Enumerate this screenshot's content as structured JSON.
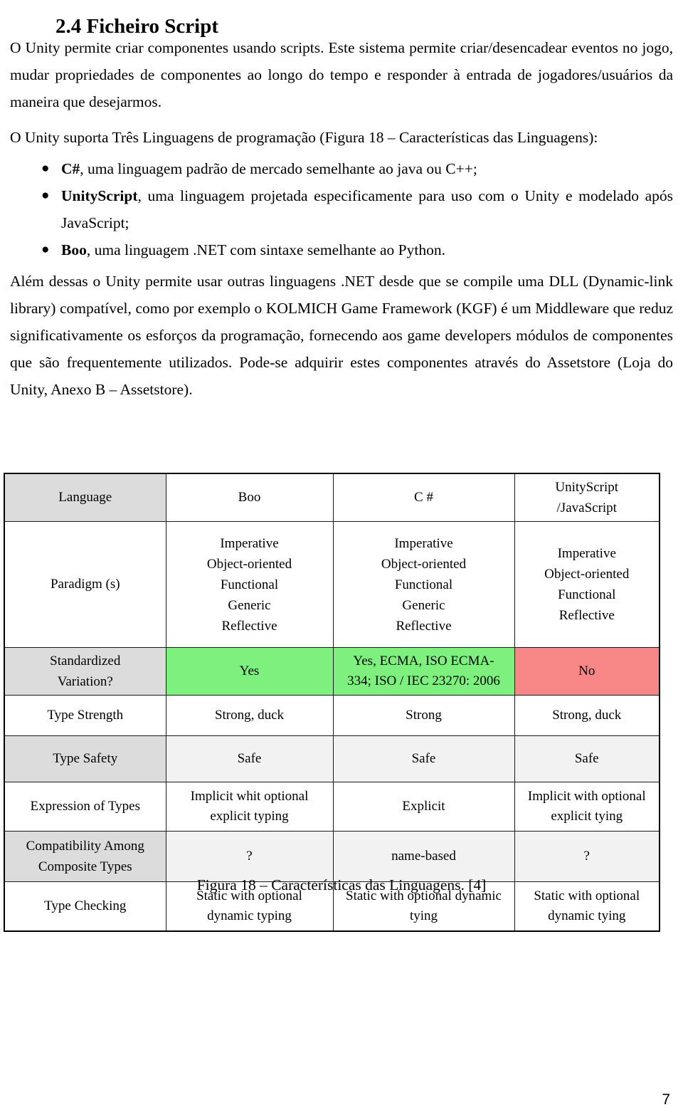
{
  "document": {
    "heading": "2.4 Ficheiro Script",
    "page_number": "7"
  },
  "paragraphs": {
    "intro": "O Unity permite criar componentes usando scripts. Este sistema permite criar/desencadear eventos no jogo, mudar propriedades de componentes ao longo do tempo e responder à entrada de jogadores/usuários da maneira que desejarmos.",
    "languages_lead": "O Unity suporta Três Linguagens de programação (Figura 18 – Características das Linguagens):",
    "closing": "Além dessas o Unity permite usar outras linguagens .NET desde que se compile uma DLL (Dynamic-link library) compatível, como por exemplo o KOLMICH Game Framework (KGF) é um Middleware que reduz significativamente os esforços da programação, fornecendo aos game developers módulos de componentes que são frequentemente utilizados. Pode-se adquirir estes componentes através do Assetstore (Loja do Unity, Anexo B – Assetstore)."
  },
  "bullets": [
    {
      "term": "C#",
      "rest": ", uma linguagem padrão de mercado semelhante ao java ou C++;"
    },
    {
      "term": "UnityScript",
      "rest": ", uma linguagem projetada especificamente para uso com o Unity e modelado após JavaScript;"
    },
    {
      "term": "Boo",
      "rest": ", uma linguagem .NET com sintaxe semelhante ao Python."
    }
  ],
  "figure": {
    "caption": "Figura 18 – Características das Linguagens. [4]"
  },
  "colors": {
    "green": "#7ef07e",
    "red": "#f78787",
    "row_label_shade": "#dcdcdc",
    "cell_shade": "#f2f2f2",
    "border": "#1a1a1a"
  },
  "chart_data": {
    "type": "table",
    "title": "Figura 18 – Características das Linguagens. [4]",
    "columns": [
      "Language",
      "Boo",
      "C #",
      "UnityScript /JavaScript"
    ],
    "rows": [
      {
        "label": "Paradigm (s)",
        "cells": [
          "Imperative\nObject-oriented\nFunctional\nGeneric\nReflective",
          "Imperative\nObject-oriented\nFunctional\nGeneric\nReflective",
          "Imperative\nObject-oriented\nFunctional\nReflective"
        ]
      },
      {
        "label": "Standardized Variation?",
        "cells": [
          "Yes",
          "Yes, ECMA, ISO ECMA-334; ISO / IEC 23270: 2006",
          "No"
        ]
      },
      {
        "label": "Type Strength",
        "cells": [
          "Strong, duck",
          "Strong",
          "Strong, duck"
        ]
      },
      {
        "label": "Type Safety",
        "cells": [
          "Safe",
          "Safe",
          "Safe"
        ]
      },
      {
        "label": "Expression of Types",
        "cells": [
          "Implicit whit optional explicit typing",
          "Explicit",
          "Implicit with optional explicit tying"
        ]
      },
      {
        "label": "Compatibility Among Composite Types",
        "cells": [
          "?",
          "name-based",
          "?"
        ]
      },
      {
        "label": "Type Checking",
        "cells": [
          "Static with optional dynamic typing",
          "Static with optional dynamic tying",
          "Static with optional dynamic tying"
        ]
      }
    ]
  },
  "table": {
    "header": {
      "label": "Language",
      "boo": "Boo",
      "csharp": "C #",
      "unityscript_line1": "UnityScript",
      "unityscript_line2": "/JavaScript"
    },
    "paradigm": {
      "label": "Paradigm (s)",
      "boo": [
        "Imperative",
        "Object-oriented",
        "Functional",
        "Generic",
        "Reflective"
      ],
      "csharp": [
        "Imperative",
        "Object-oriented",
        "Functional",
        "Generic",
        "Reflective"
      ],
      "unityscript": [
        "Imperative",
        "Object-oriented",
        "Functional",
        "Reflective"
      ]
    },
    "standardized": {
      "label_line1": "Standardized",
      "label_line2": "Variation?",
      "boo": "Yes",
      "csharp_line1": "Yes, ECMA, ISO ECMA-",
      "csharp_line2": "334; ISO / IEC 23270: 2006",
      "unityscript": "No"
    },
    "type_strength": {
      "label": "Type Strength",
      "boo": "Strong, duck",
      "csharp": "Strong",
      "unityscript": "Strong, duck"
    },
    "type_safety": {
      "label": "Type Safety",
      "boo": "Safe",
      "csharp": "Safe",
      "unityscript": "Safe"
    },
    "expression": {
      "label": "Expression of Types",
      "boo_line1": "Implicit whit optional",
      "boo_line2": "explicit typing",
      "csharp": "Explicit",
      "unityscript_line1": "Implicit with optional",
      "unityscript_line2": "explicit tying"
    },
    "compatibility": {
      "label_line1": "Compatibility Among",
      "label_line2": "Composite Types",
      "boo": "?",
      "csharp": "name-based",
      "unityscript": "?"
    },
    "type_checking": {
      "label": "Type Checking",
      "boo_line1": "Static with optional",
      "boo_line2": "dynamic typing",
      "csharp_line1": "Static with optional dynamic",
      "csharp_line2": "tying",
      "unityscript_line1": "Static with optional",
      "unityscript_line2": "dynamic tying"
    }
  }
}
